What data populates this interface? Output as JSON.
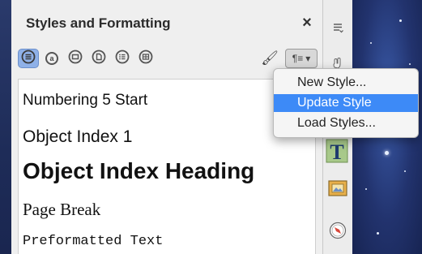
{
  "panel": {
    "title": "Styles and Formatting",
    "close_glyph": "×"
  },
  "toolbar": {
    "buttons": [
      {
        "icon": "paragraph-styles-icon",
        "active": true
      },
      {
        "icon": "character-styles-icon",
        "glyph": "a"
      },
      {
        "icon": "frame-styles-icon"
      },
      {
        "icon": "page-styles-icon"
      },
      {
        "icon": "list-styles-icon"
      },
      {
        "icon": "table-styles-icon"
      }
    ],
    "fill_format_glyph": "🖌",
    "style_actions_glyph": "¶≡",
    "style_actions_arrow": "▾"
  },
  "styles_list": [
    "Numbering 5 Start",
    "Object Index 1",
    "Object Index Heading",
    "Page Break",
    "Preformatted Text"
  ],
  "menu": {
    "items": [
      "New Style...",
      "Update Style",
      "Load Styles..."
    ],
    "highlighted_index": 1
  },
  "sidebar": {
    "icons": [
      "sidebar-menu-icon",
      "hand-icon",
      "styles-icon",
      "gallery-icon",
      "navigator-icon"
    ]
  },
  "colors": {
    "highlight": "#3d8af7",
    "active_button": "#8fb1e8"
  }
}
